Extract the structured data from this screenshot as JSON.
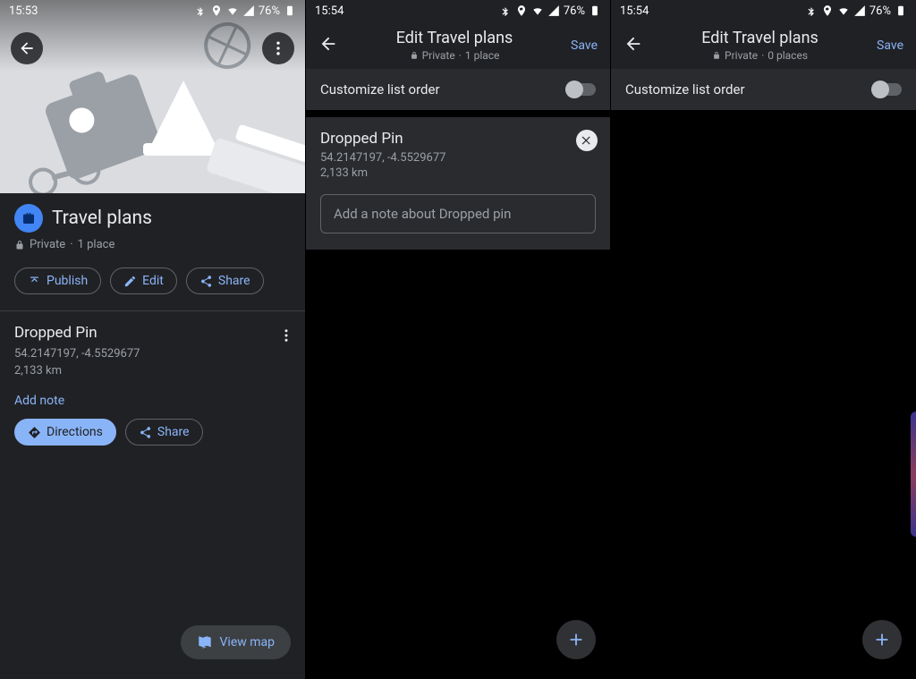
{
  "screen1": {
    "status": {
      "time": "15:53",
      "battery": "76%"
    },
    "list_title": "Travel plans",
    "visibility": "Private",
    "place_count": "1 place",
    "chips": {
      "publish": "Publish",
      "edit": "Edit",
      "share": "Share"
    },
    "place": {
      "name": "Dropped Pin",
      "coords": "54.2147197, -4.5529677",
      "distance": "2,133 km",
      "add_note": "Add note",
      "directions": "Directions",
      "share": "Share"
    },
    "view_map": "View map"
  },
  "screen2": {
    "status": {
      "time": "15:54",
      "battery": "76%"
    },
    "title": "Edit Travel plans",
    "visibility": "Private",
    "place_count": "1 place",
    "save": "Save",
    "customize": "Customize list order",
    "place": {
      "name": "Dropped Pin",
      "coords": "54.2147197, -4.5529677",
      "distance": "2,133 km",
      "note_placeholder": "Add a note about Dropped pin"
    }
  },
  "screen3": {
    "status": {
      "time": "15:54",
      "battery": "76%"
    },
    "title": "Edit Travel plans",
    "visibility": "Private",
    "place_count": "0 places",
    "save": "Save",
    "customize": "Customize list order"
  }
}
